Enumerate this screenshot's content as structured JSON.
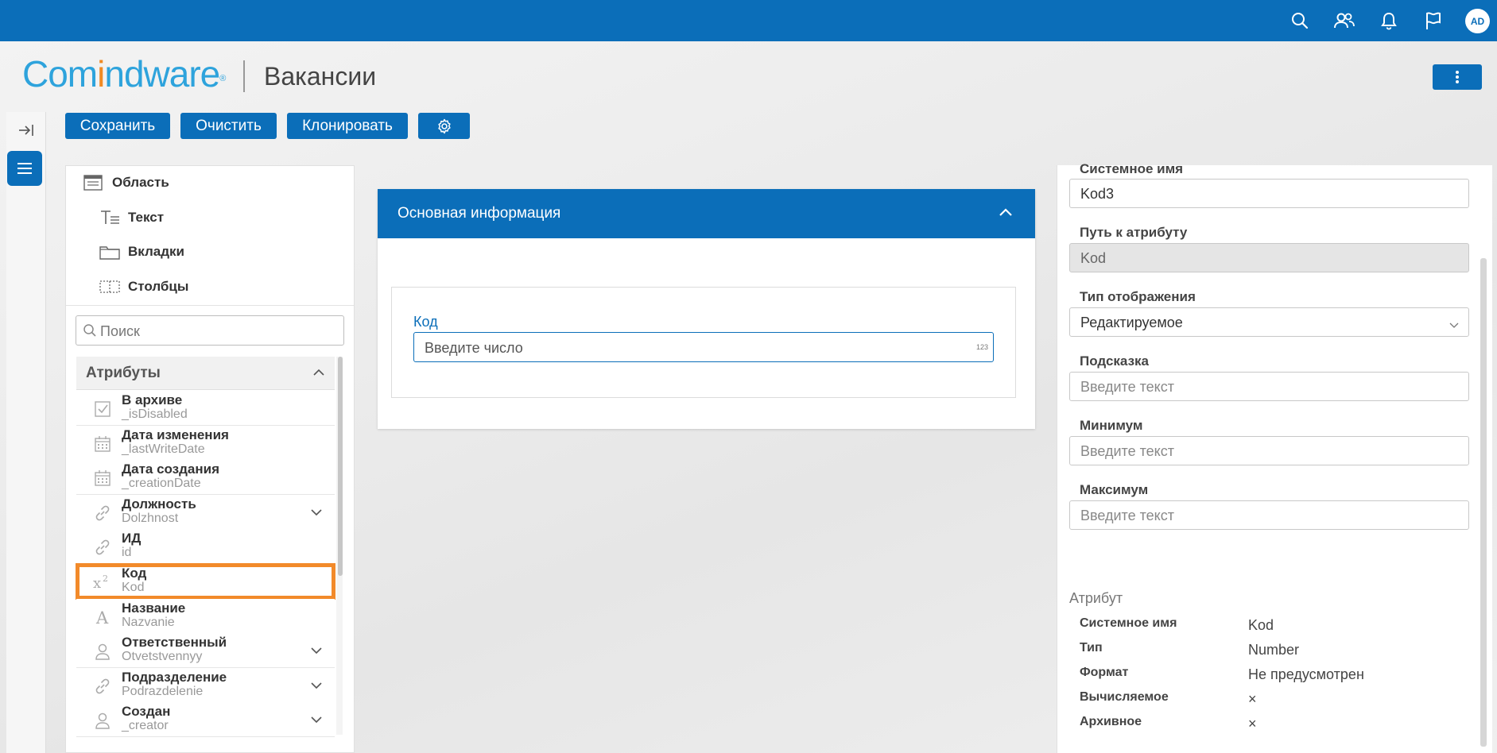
{
  "app": {
    "brand_part1": "Com",
    "brand_part2": "i",
    "brand_part3": "ndware",
    "brand_reg": "®",
    "page_title": "Вакансии",
    "user_initials": "AD"
  },
  "colors": {
    "primary": "#0b6eb9",
    "highlight": "#f28a2a"
  },
  "topbar_icons": [
    "search-icon",
    "users-icon",
    "bell-icon",
    "flag-icon"
  ],
  "toolbar": {
    "save": "Сохранить",
    "clear": "Очистить",
    "clone": "Клонировать",
    "settings_icon": "gear-icon"
  },
  "palette": [
    {
      "label": "Область",
      "icon": "area-icon"
    },
    {
      "label": "Текст",
      "icon": "text-icon"
    },
    {
      "label": "Вкладки",
      "icon": "tabs-icon"
    },
    {
      "label": "Столбцы",
      "icon": "columns-icon"
    }
  ],
  "search": {
    "placeholder": "Поиск"
  },
  "attributes": {
    "header": "Атрибуты",
    "items": [
      {
        "name": "В архиве",
        "system": "_isDisabled",
        "icon": "checkbox-icon",
        "expandable": false
      },
      {
        "name": "Дата изменения",
        "system": "_lastWriteDate",
        "icon": "calendar-icon",
        "expandable": false
      },
      {
        "name": "Дата создания",
        "system": "_creationDate",
        "icon": "calendar-icon",
        "expandable": false
      },
      {
        "name": "Должность",
        "system": "Dolzhnost",
        "icon": "link-icon",
        "expandable": true
      },
      {
        "name": "ИД",
        "system": "id",
        "icon": "link-icon",
        "expandable": false
      },
      {
        "name": "Код",
        "system": "Kod",
        "icon": "number-icon",
        "expandable": false,
        "selected": true
      },
      {
        "name": "Название",
        "system": "Nazvanie",
        "icon": "text-type-icon",
        "expandable": false
      },
      {
        "name": "Ответственный",
        "system": "Otvetstvennyy",
        "icon": "user-icon",
        "expandable": true
      },
      {
        "name": "Подразделение",
        "system": "Podrazdelenie",
        "icon": "link-icon",
        "expandable": true
      },
      {
        "name": "Создан",
        "system": "_creator",
        "icon": "user-icon",
        "expandable": true
      }
    ]
  },
  "form": {
    "section_title": "Основная информация",
    "field_label": "Код",
    "field_placeholder": "Введите число",
    "field_badge": "123"
  },
  "properties": {
    "system_name_label": "Системное имя",
    "system_name_value": "Kod3",
    "path_label": "Путь к атрибуту",
    "path_value": "Kod",
    "display_type_label": "Тип отображения",
    "display_type_value": "Редактируемое",
    "hint_label": "Подсказка",
    "hint_placeholder": "Введите текст",
    "min_label": "Минимум",
    "min_placeholder": "Введите текст",
    "max_label": "Максимум",
    "max_placeholder": "Введите текст"
  },
  "attribute_info": {
    "title": "Атрибут",
    "rows": [
      {
        "key": "Системное имя",
        "value": "Kod"
      },
      {
        "key": "Тип",
        "value": "Number"
      },
      {
        "key": "Формат",
        "value": "Не предусмотрен"
      },
      {
        "key": "Вычисляемое",
        "value": "×"
      },
      {
        "key": "Архивное",
        "value": "×"
      }
    ]
  }
}
